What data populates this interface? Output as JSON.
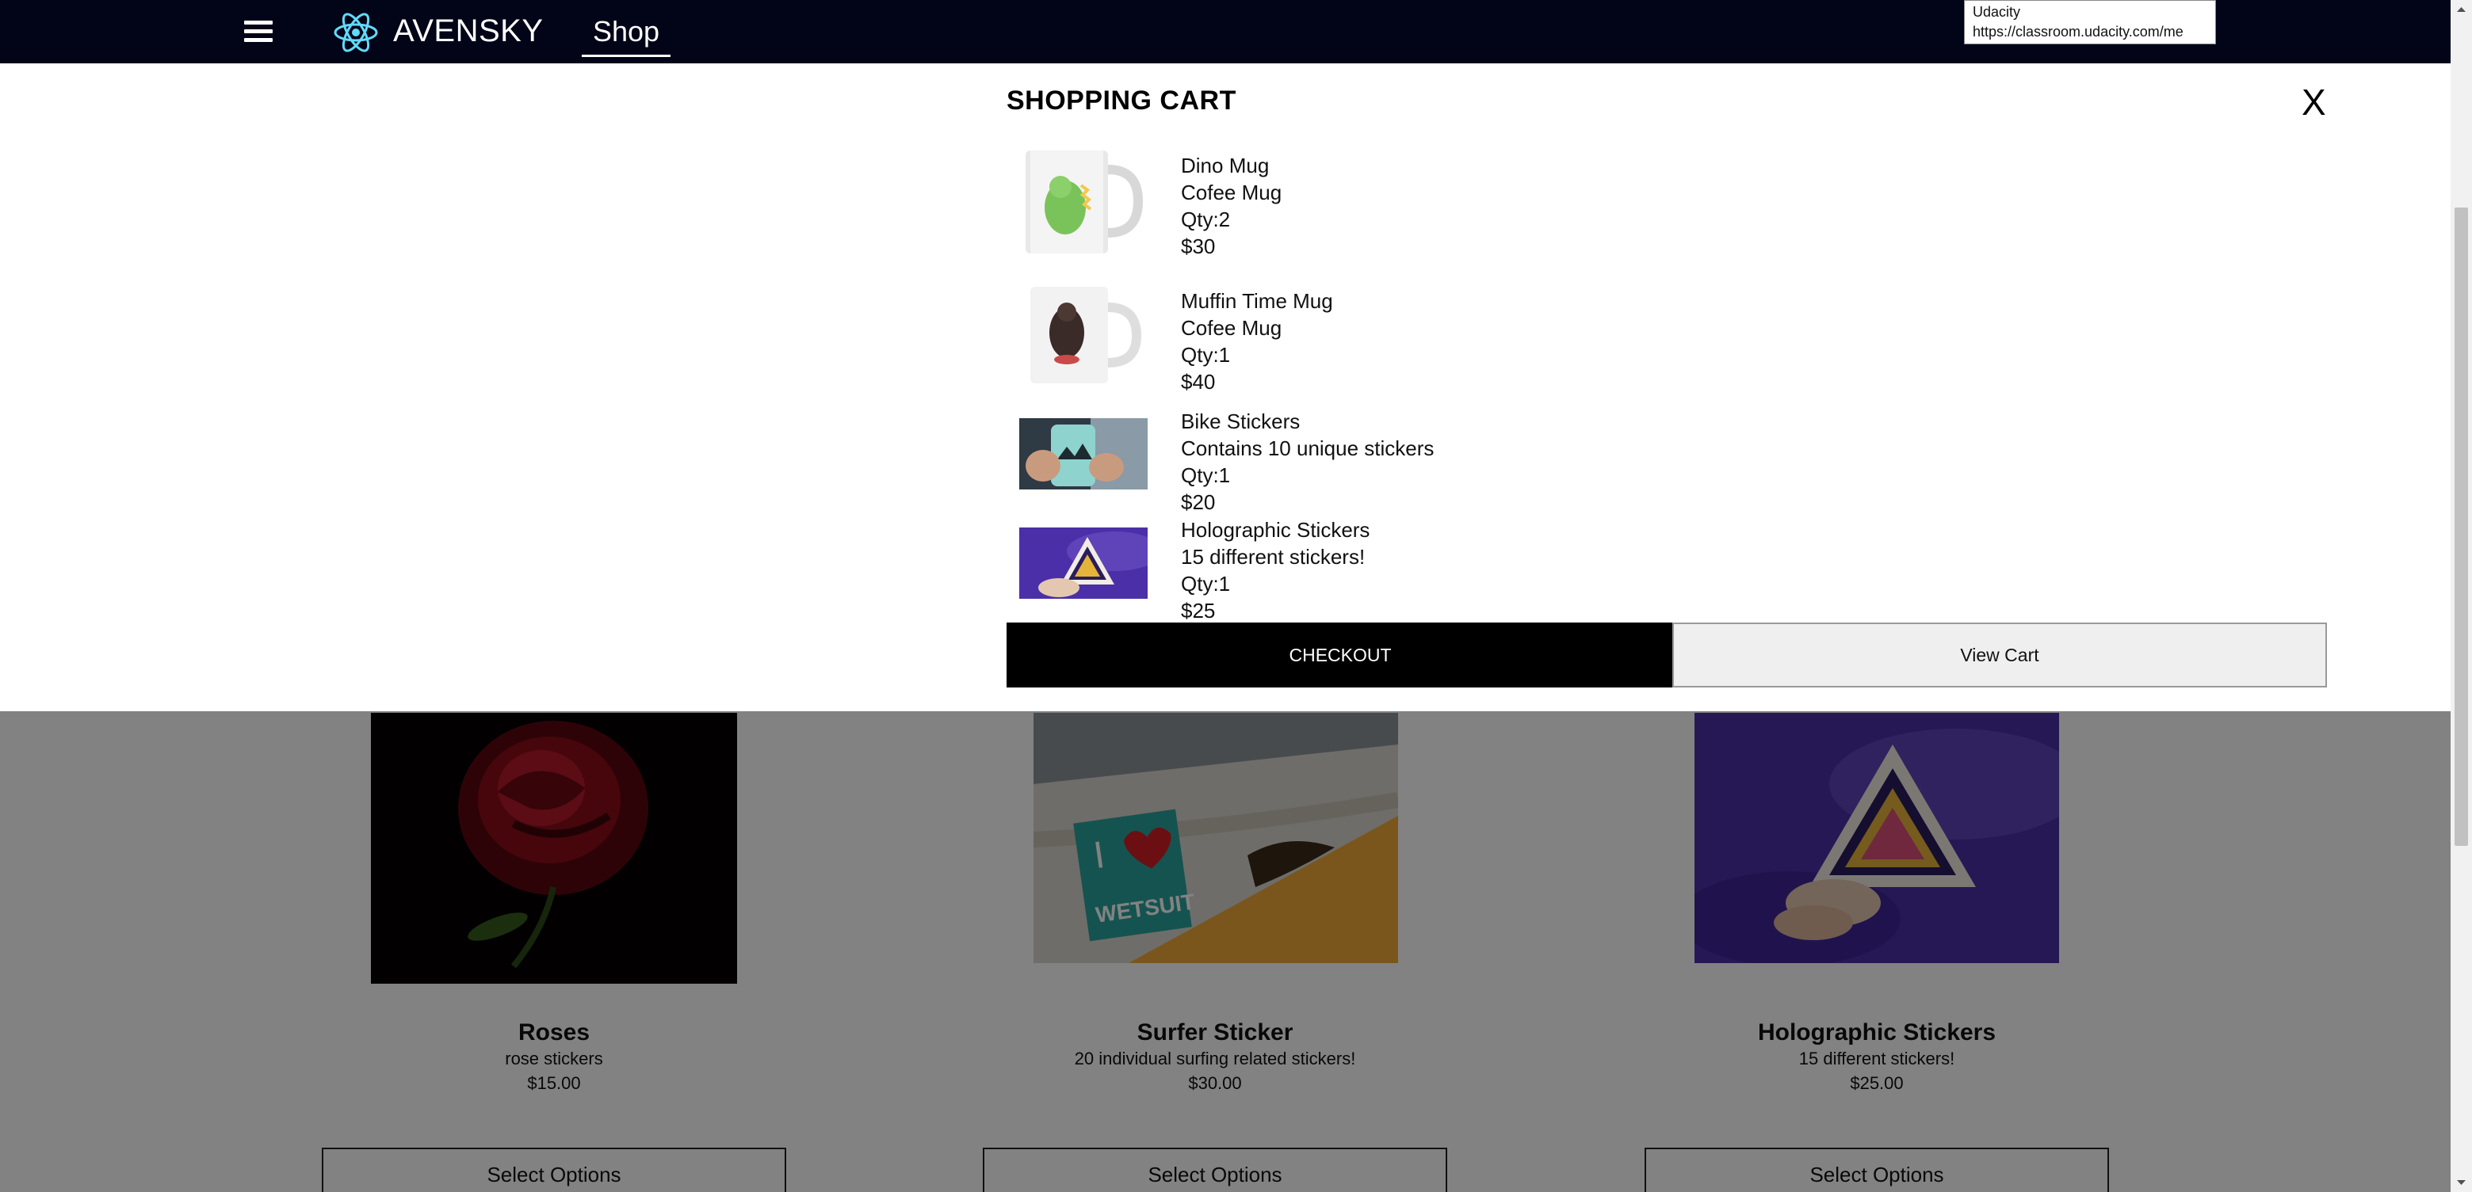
{
  "nav": {
    "brand": "AVENSKY",
    "shop": "Shop"
  },
  "tooltip": {
    "title": "Udacity",
    "url": "https://classroom.udacity.com/me"
  },
  "cart": {
    "title": "SHOPPING CART",
    "close": "X",
    "items": [
      {
        "name": "Dino Mug",
        "desc": "Cofee Mug",
        "qty": "Qty:2",
        "price": "$30"
      },
      {
        "name": "Muffin Time Mug",
        "desc": "Cofee Mug",
        "qty": "Qty:1",
        "price": "$40"
      },
      {
        "name": "Bike Stickers",
        "desc": "Contains 10 unique stickers",
        "qty": "Qty:1",
        "price": "$20"
      },
      {
        "name": "Holographic Stickers",
        "desc": "15 different stickers!",
        "qty": "Qty:1",
        "price": "$25"
      }
    ],
    "checkout": "CHECKOUT",
    "view_cart": "View Cart"
  },
  "products": [
    {
      "title": "Roses",
      "desc": "rose stickers",
      "price": "$15.00",
      "button": "Select Options"
    },
    {
      "title": "Surfer Sticker",
      "desc": "20 individual surfing related stickers!",
      "price": "$30.00",
      "button": "Select Options"
    },
    {
      "title": "Holographic Stickers",
      "desc": "15 different stickers!",
      "price": "$25.00",
      "button": "Select Options"
    }
  ],
  "icons": {
    "menu": "hamburger-menu-icon",
    "logo": "atom-logo-icon"
  },
  "colors": {
    "nav_bg": "#020417",
    "checkout_bg": "#000000",
    "overlay": "rgba(0,0,0,0.49)"
  }
}
